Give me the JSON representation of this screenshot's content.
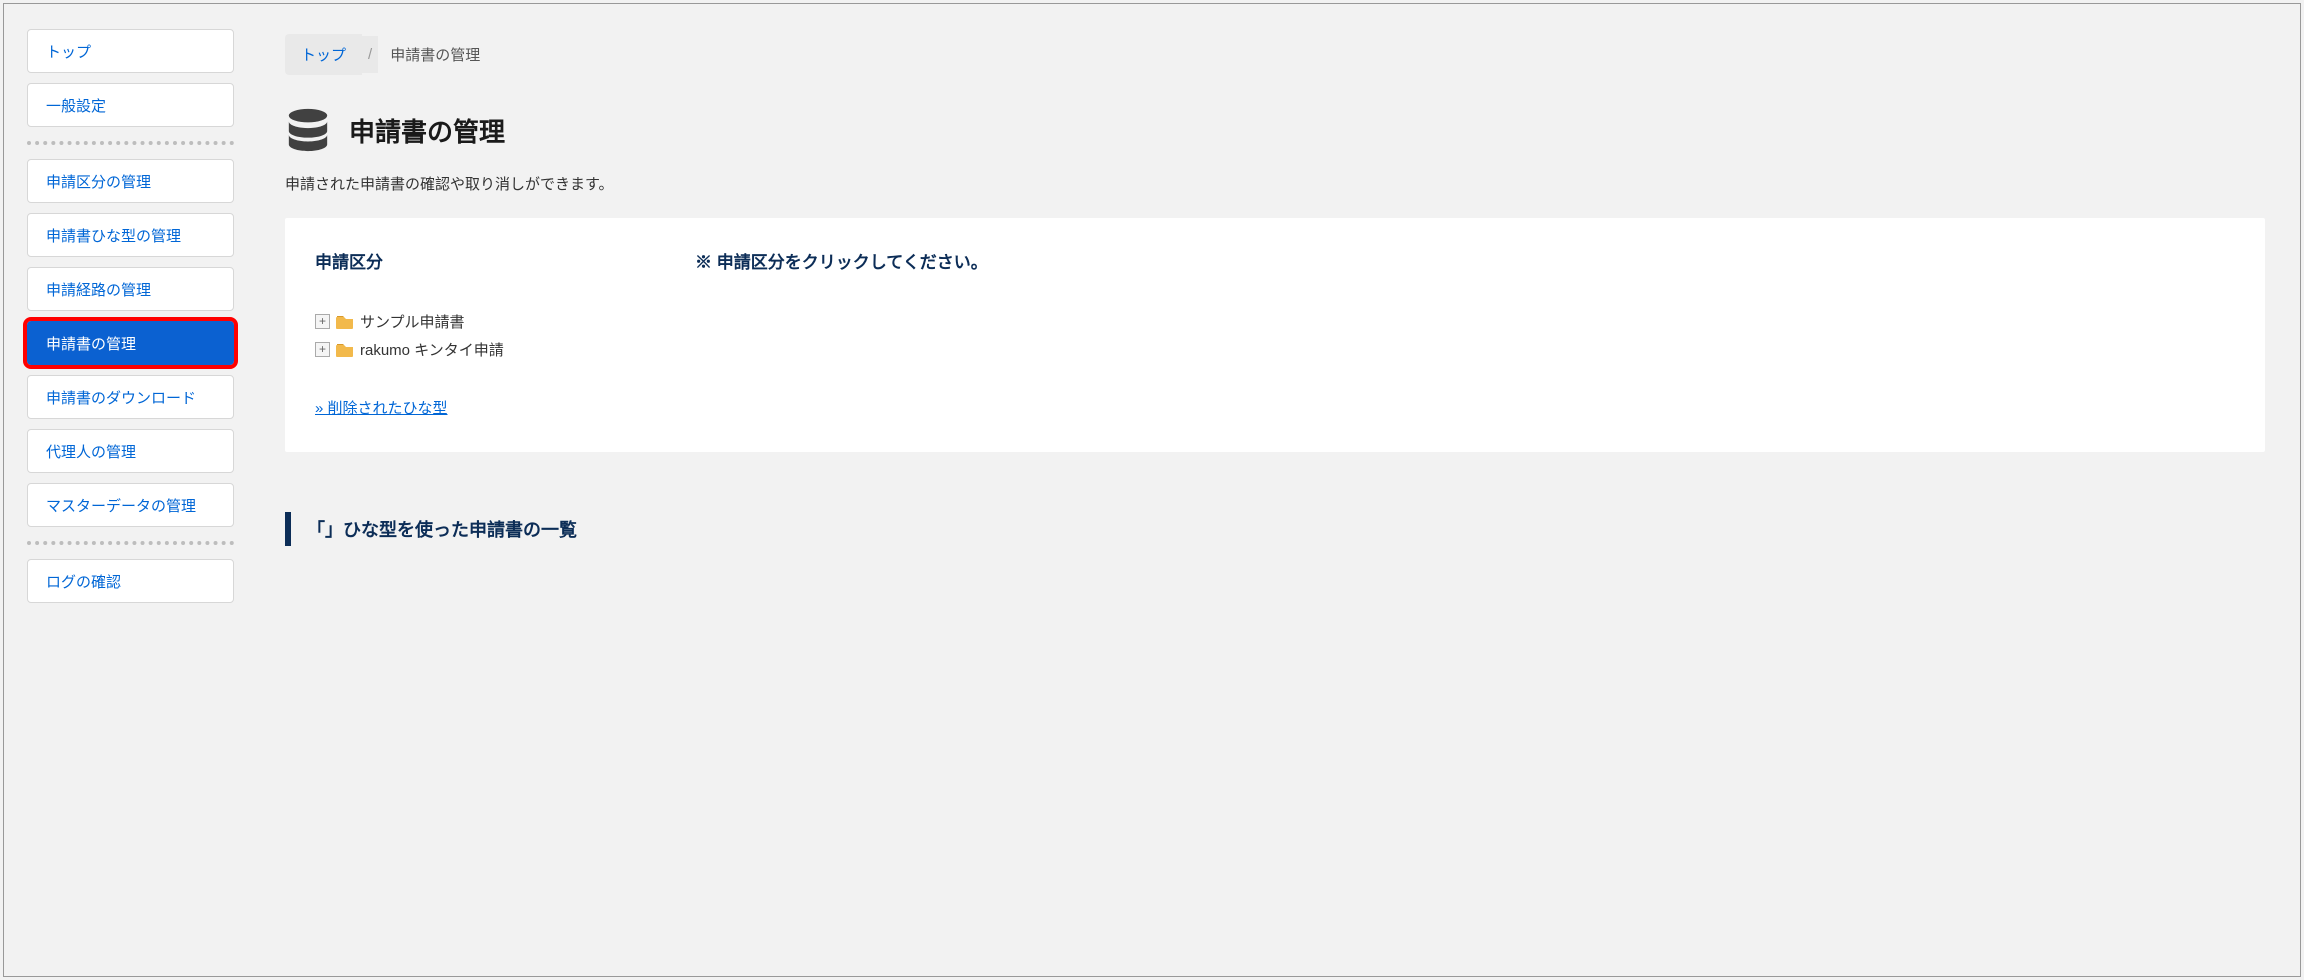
{
  "sidebar": {
    "items": [
      {
        "label": "トップ"
      },
      {
        "label": "一般設定"
      },
      {
        "label": "申請区分の管理"
      },
      {
        "label": "申請書ひな型の管理"
      },
      {
        "label": "申請経路の管理"
      },
      {
        "label": "申請書の管理"
      },
      {
        "label": "申請書のダウンロード"
      },
      {
        "label": "代理人の管理"
      },
      {
        "label": "マスターデータの管理"
      },
      {
        "label": "ログの確認"
      }
    ]
  },
  "breadcrumb": {
    "root": "トップ",
    "sep": "/",
    "current": "申請書の管理"
  },
  "page": {
    "title": "申請書の管理",
    "description": "申請された申請書の確認や取り消しができます。"
  },
  "panel": {
    "section_title": "申請区分",
    "instruction": "※ 申請区分をクリックしてください。",
    "tree": [
      {
        "label": "サンプル申請書"
      },
      {
        "label": "rakumo キンタイ申請"
      }
    ],
    "deleted_link": "» 削除されたひな型"
  },
  "subheading": "「」ひな型を使った申請書の一覧"
}
